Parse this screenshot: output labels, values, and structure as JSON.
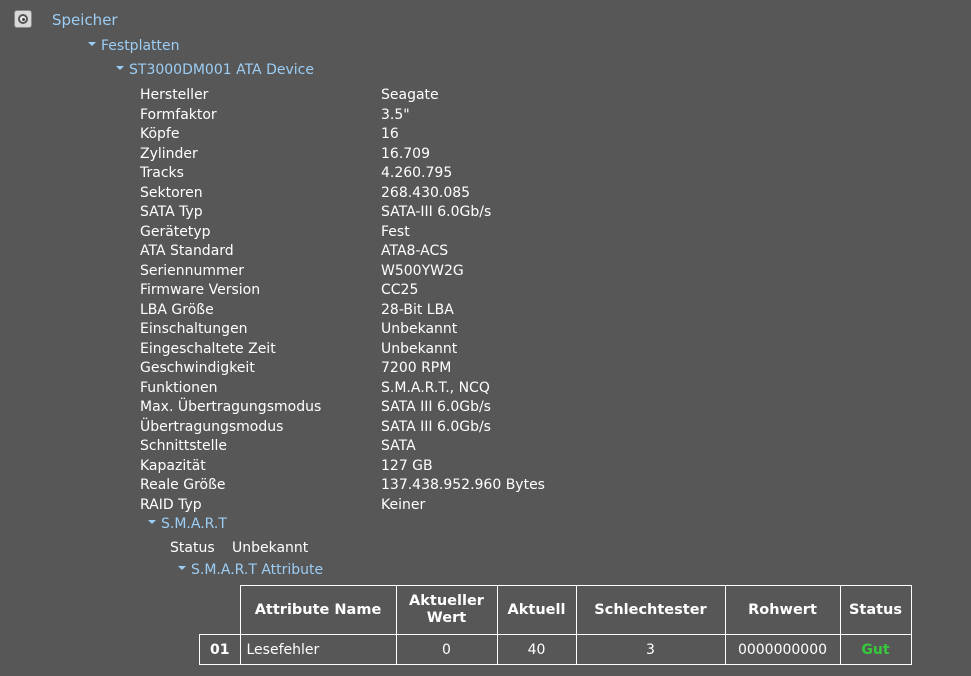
{
  "tree": {
    "root_label": "Speicher",
    "root_icon": "storage-icon",
    "group_label": "Festplatten",
    "device_label": "ST3000DM001 ATA Device",
    "properties": [
      {
        "key": "Hersteller",
        "value": "Seagate"
      },
      {
        "key": "Formfaktor",
        "value": "3.5\""
      },
      {
        "key": "Köpfe",
        "value": "16"
      },
      {
        "key": "Zylinder",
        "value": "16.709"
      },
      {
        "key": "Tracks",
        "value": "4.260.795"
      },
      {
        "key": "Sektoren",
        "value": "268.430.085"
      },
      {
        "key": "SATA Typ",
        "value": "SATA-III 6.0Gb/s"
      },
      {
        "key": "Gerätetyp",
        "value": "Fest"
      },
      {
        "key": "ATA Standard",
        "value": "ATA8-ACS"
      },
      {
        "key": "Seriennummer",
        "value": "W500YW2G"
      },
      {
        "key": "Firmware Version",
        "value": "CC25"
      },
      {
        "key": "LBA Größe",
        "value": "28-Bit LBA"
      },
      {
        "key": "Einschaltungen",
        "value": "Unbekannt"
      },
      {
        "key": "Eingeschaltete Zeit",
        "value": "Unbekannt"
      },
      {
        "key": "Geschwindigkeit",
        "value": "7200 RPM"
      },
      {
        "key": "Funktionen",
        "value": "S.M.A.R.T., NCQ"
      },
      {
        "key": "Max. Übertragungsmodus",
        "value": "SATA III 6.0Gb/s"
      },
      {
        "key": "Übertragungsmodus",
        "value": "SATA III 6.0Gb/s"
      },
      {
        "key": "Schnittstelle",
        "value": "SATA"
      },
      {
        "key": "Kapazität",
        "value": "127 GB"
      },
      {
        "key": "Reale Größe",
        "value": "137.438.952.960 Bytes"
      },
      {
        "key": "RAID Typ",
        "value": "Keiner"
      }
    ],
    "smart_label": "S.M.A.R.T",
    "smart_status_key": "Status",
    "smart_status_value": "Unbekannt",
    "smart_attributes_label": "S.M.A.R.T Attribute"
  },
  "smart_table": {
    "headers": {
      "name": "Attribute Name",
      "current_line1": "Aktueller",
      "current_line2": "Wert",
      "actual": "Aktuell",
      "worst": "Schlechtester",
      "raw": "Rohwert",
      "status": "Status"
    },
    "rows": [
      {
        "id": "01",
        "name": "Lesefehler",
        "current": "0",
        "actual": "40",
        "worst": "3",
        "raw": "0000000000",
        "status": "Gut"
      }
    ]
  },
  "colors": {
    "background": "#575757",
    "link": "#9ccdf4",
    "status_good": "#35c93a"
  }
}
